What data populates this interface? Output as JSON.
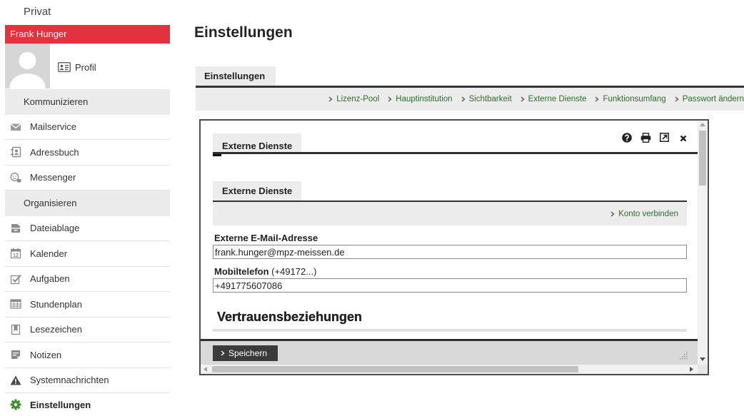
{
  "theme": {
    "user_bar": "#e2323d",
    "link_green": "#2f6b2f",
    "active_icon": "#3f8f2f"
  },
  "sidebar": {
    "area_title": "Privat",
    "user_name": "Frank Hunger",
    "profile_label": "Profil",
    "profile_icon": "profile-card-icon",
    "groups": [
      {
        "title": "Kommunizieren",
        "items": [
          {
            "label": "Mailservice",
            "icon": "envelope-icon"
          },
          {
            "label": "Adressbuch",
            "icon": "address-book-icon"
          },
          {
            "label": "Messenger",
            "icon": "messenger-icon"
          }
        ]
      },
      {
        "title": "Organisieren",
        "items": [
          {
            "label": "Dateiablage",
            "icon": "file-storage-icon"
          },
          {
            "label": "Kalender",
            "icon": "calendar-icon",
            "icon_text": "12"
          },
          {
            "label": "Aufgaben",
            "icon": "task-checkbox-icon"
          },
          {
            "label": "Stundenplan",
            "icon": "timetable-icon"
          },
          {
            "label": "Lesezeichen",
            "icon": "bookmark-icon"
          },
          {
            "label": "Notizen",
            "icon": "note-icon"
          },
          {
            "label": "Systemnachrichten",
            "icon": "warning-icon"
          },
          {
            "label": "Einstellungen",
            "icon": "gear-icon",
            "active": true
          }
        ]
      }
    ]
  },
  "main": {
    "page_title": "Einstellungen",
    "tab": "Einstellungen",
    "subnav": [
      "Lizenz-Pool",
      "Hauptinstitution",
      "Sichtbarkeit",
      "Externe Dienste",
      "Funktionsumfang",
      "Passwort ändern"
    ]
  },
  "dialog": {
    "tab": "Externe Dienste",
    "toolbar_icons": [
      "help-icon",
      "print-icon",
      "popout-icon",
      "close-icon"
    ],
    "section_tab": "Externe Dienste",
    "connect_link": "Konto verbinden",
    "email": {
      "label": "Externe E-Mail-Adresse",
      "value": "frank.hunger@mpz-meissen.de"
    },
    "mobile": {
      "label": "Mobiltelefon",
      "hint": "(+49172...)",
      "value": "+491775607086"
    },
    "trust_heading": "Vertrauensbeziehungen",
    "save_label": "Speichern"
  }
}
